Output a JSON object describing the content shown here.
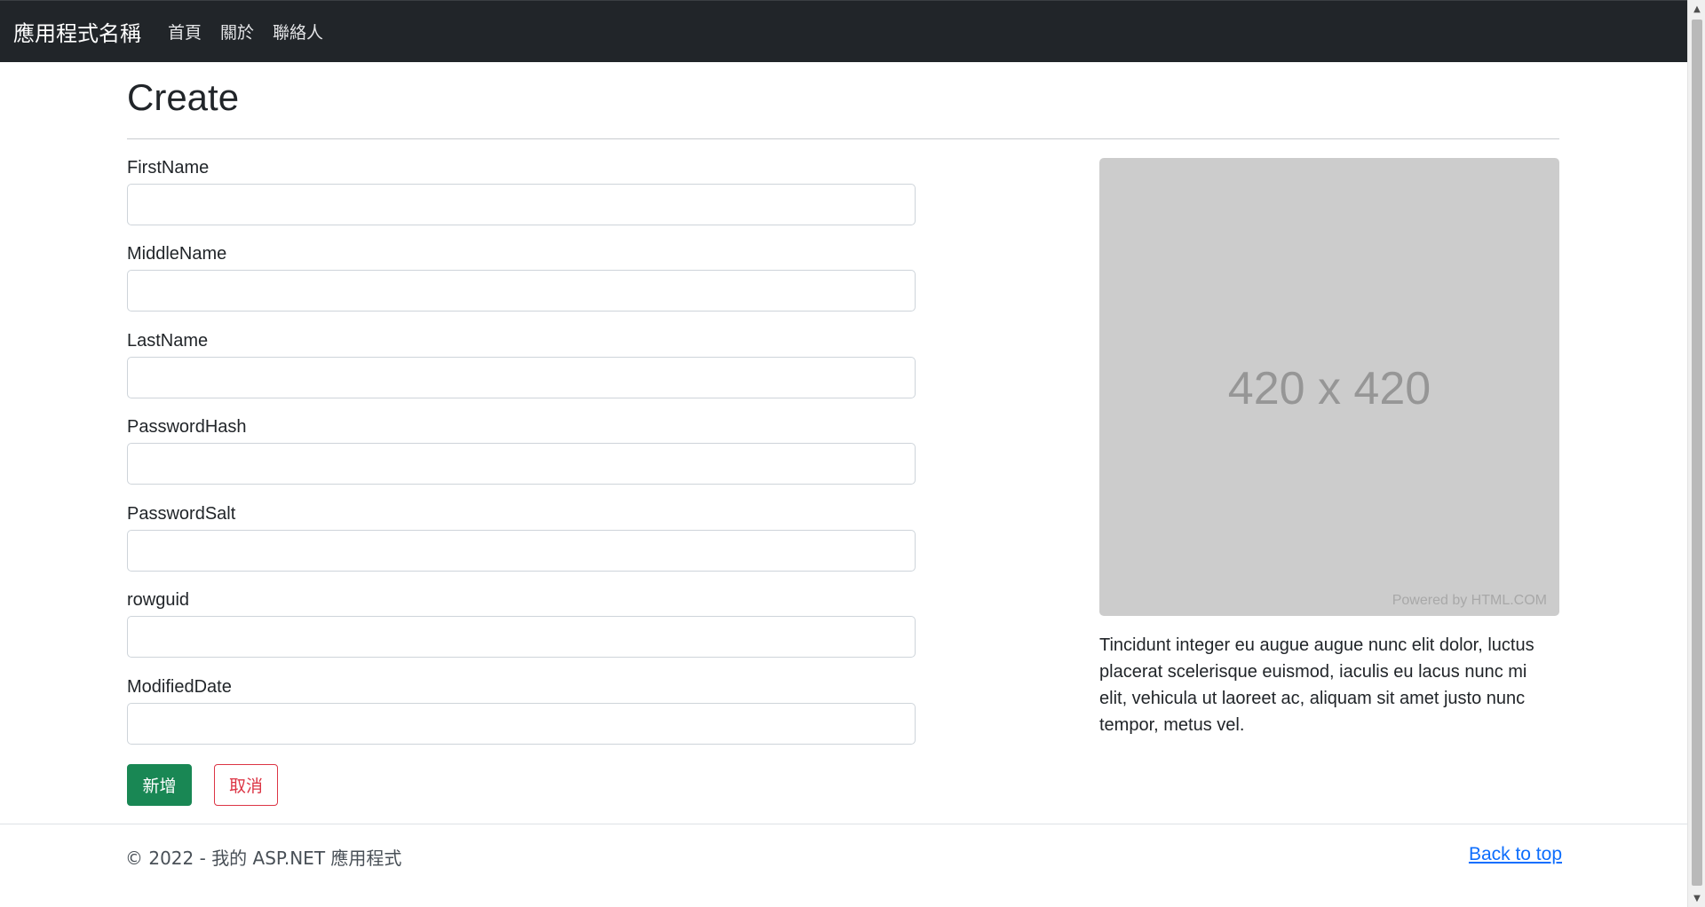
{
  "navbar": {
    "brand": "應用程式名稱",
    "links": [
      "首頁",
      "關於",
      "聯絡人"
    ]
  },
  "page": {
    "title": "Create"
  },
  "form": {
    "fields": [
      {
        "label": "FirstName",
        "value": ""
      },
      {
        "label": "MiddleName",
        "value": ""
      },
      {
        "label": "LastName",
        "value": ""
      },
      {
        "label": "PasswordHash",
        "value": ""
      },
      {
        "label": "PasswordSalt",
        "value": ""
      },
      {
        "label": "rowguid",
        "value": ""
      },
      {
        "label": "ModifiedDate",
        "value": ""
      }
    ],
    "submit_label": "新增",
    "cancel_label": "取消"
  },
  "aside": {
    "image_text": "420 x 420",
    "image_credit": "Powered by HTML.COM",
    "paragraph": "Tincidunt integer eu augue augue nunc elit dolor, luctus placerat scelerisque euismod, iaculis eu lacus nunc mi elit, vehicula ut laoreet ac, aliquam sit amet justo nunc tempor, metus vel."
  },
  "footer": {
    "copyright": "© 2022 - 我的 ASP.NET 應用程式",
    "back_to_top": "Back to top"
  },
  "colors": {
    "navbar_bg": "#212529",
    "success": "#198754",
    "danger": "#dc3545",
    "link": "#0d6efd"
  },
  "icons": {
    "scroll_up": "triangle-up-icon",
    "scroll_down": "triangle-down-icon"
  }
}
